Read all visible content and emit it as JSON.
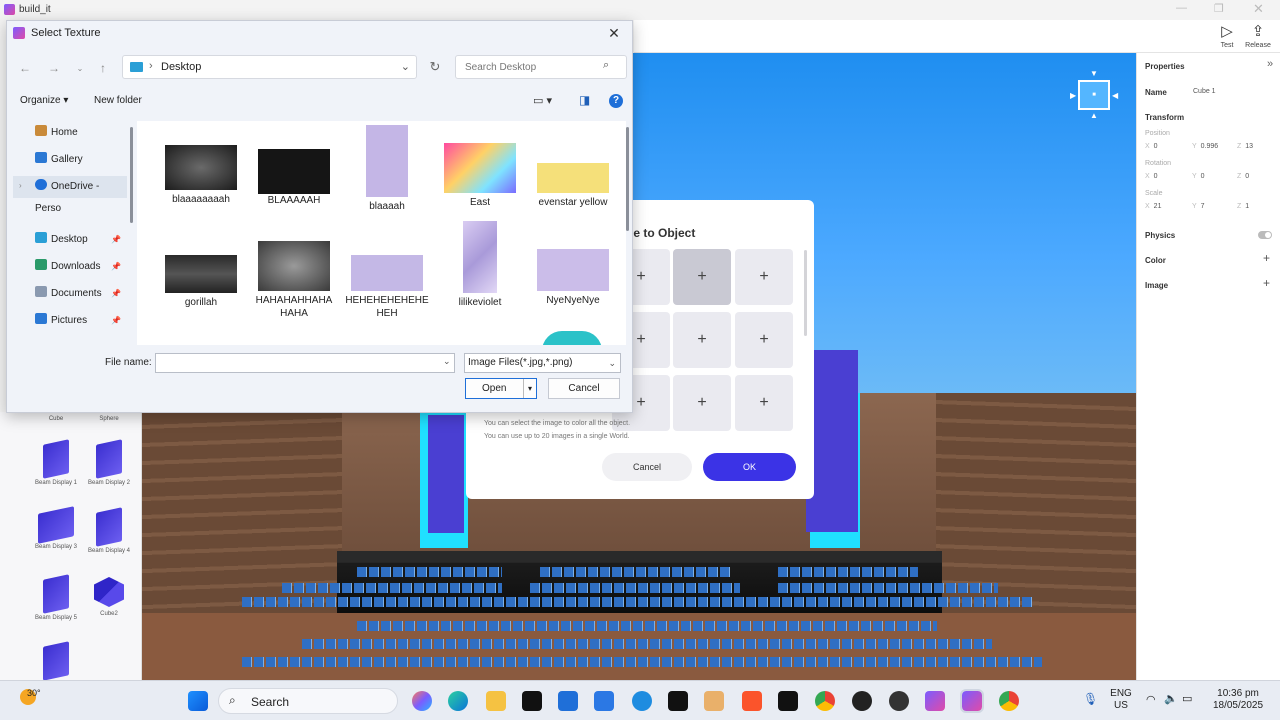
{
  "app": {
    "title": "build_it"
  },
  "toolbar": {
    "test_label": "Test",
    "release_label": "Release"
  },
  "assets": [
    {
      "label": "Cube"
    },
    {
      "label": "Sphere"
    },
    {
      "label": "Beam Display 1"
    },
    {
      "label": "Beam Display 2"
    },
    {
      "label": "Beam Display 3"
    },
    {
      "label": "Beam Display 4"
    },
    {
      "label": "Beam Display 5"
    },
    {
      "label": "Cube2"
    }
  ],
  "properties": {
    "title": "Properties",
    "name_label": "Name",
    "name_value": "Cube 1",
    "transform_label": "Transform",
    "position_label": "Position",
    "position": {
      "x": "0",
      "y": "0.996",
      "z": "13"
    },
    "rotation_label": "Rotation",
    "rotation": {
      "x": "0",
      "y": "0",
      "z": "0"
    },
    "scale_label": "Scale",
    "scale": {
      "x": "21",
      "y": "7",
      "z": "1"
    },
    "physics_label": "Physics",
    "color_label": "Color",
    "image_label": "Image"
  },
  "modal": {
    "title": "ge to Object",
    "note_1": "You can select the image to color all the object.",
    "note_2": "You can use up to 20 images in a single World.",
    "cancel_label": "Cancel",
    "ok_label": "OK"
  },
  "dialog": {
    "title": "Select Texture",
    "path": "Desktop",
    "search_placeholder": "Search Desktop",
    "organize_label": "Organize ▾",
    "new_folder_label": "New folder",
    "nav": [
      {
        "label": "Home"
      },
      {
        "label": "Gallery"
      },
      {
        "label": "OneDrive - Perso"
      },
      {
        "label": "Desktop"
      },
      {
        "label": "Downloads"
      },
      {
        "label": "Documents"
      },
      {
        "label": "Pictures"
      }
    ],
    "files": [
      {
        "name": "blaaaaaaaah"
      },
      {
        "name": "BLAAAAAH"
      },
      {
        "name": "blaaaah"
      },
      {
        "name": "East"
      },
      {
        "name": "evenstar yellow"
      },
      {
        "name": "gorillah"
      },
      {
        "name": "HAHAHAHHAHA HAHA"
      },
      {
        "name": "HEHEHEHEHEHE HEH"
      },
      {
        "name": "lilikeviolet"
      },
      {
        "name": "NyeNyeNye"
      }
    ],
    "file_name_label": "File name:",
    "file_name_value": "",
    "file_type": "Image Files(*.jpg,*.png)",
    "open_label": "Open",
    "cancel_label": "Cancel"
  },
  "taskbar": {
    "weather": "30°",
    "search_label": "Search",
    "lang_1": "ENG",
    "lang_2": "US",
    "time": "10:36 pm",
    "date": "18/05/2025"
  }
}
